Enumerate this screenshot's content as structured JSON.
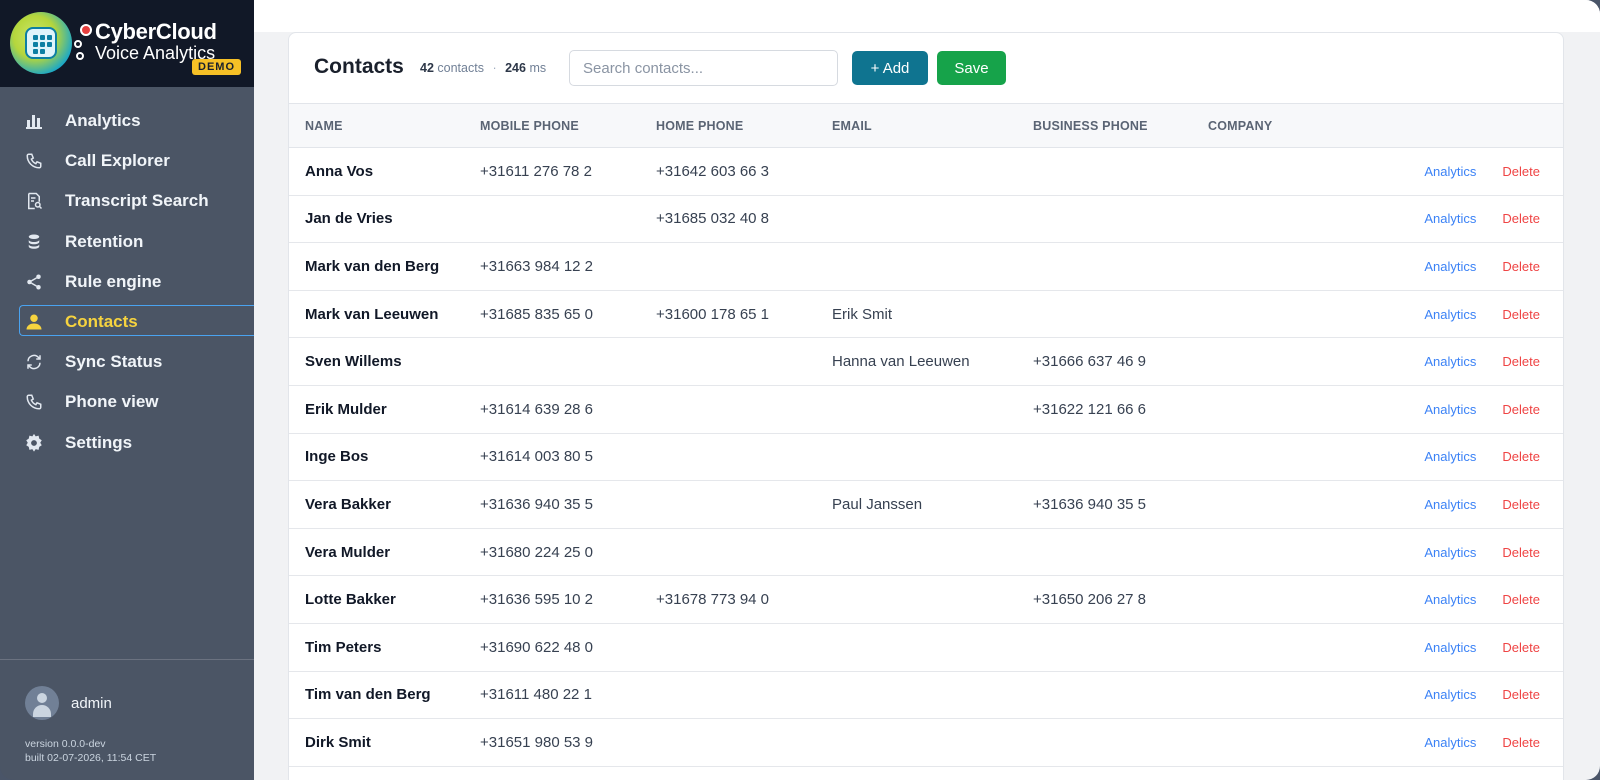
{
  "app": {
    "title": "CyberCloud",
    "subtitle": "Voice Analytics",
    "badge": "DEMO"
  },
  "sidebar": {
    "items": [
      {
        "label": "Analytics",
        "icon": "bar-chart-icon"
      },
      {
        "label": "Call Explorer",
        "icon": "phone-icon"
      },
      {
        "label": "Transcript Search",
        "icon": "document-search-icon"
      },
      {
        "label": "Retention",
        "icon": "database-icon"
      },
      {
        "label": "Rule engine",
        "icon": "share-icon"
      },
      {
        "label": "Contacts",
        "icon": "user-icon",
        "active": true
      },
      {
        "label": "Sync Status",
        "icon": "sync-icon"
      },
      {
        "label": "Phone view",
        "icon": "phone-icon"
      },
      {
        "label": "Settings",
        "icon": "gear-icon"
      }
    ],
    "user": "admin",
    "version": "version 0.0.0-dev",
    "built": "built 02-07-2026, 11:54 CET"
  },
  "header": {
    "title": "Contacts",
    "count": "42",
    "count_label": "contacts",
    "separator": "·",
    "time": "246",
    "time_label": "ms",
    "search_placeholder": "Search contacts...",
    "add_label": "+ Add",
    "save_label": "Save"
  },
  "table": {
    "columns": [
      "Name",
      "Mobile Phone",
      "Home Phone",
      "Email",
      "Business Phone",
      "Company"
    ],
    "action_analytics": "Analytics",
    "action_delete": "Delete",
    "rows": [
      {
        "name": "Anna Vos",
        "mobile": "+31611 276 78 2",
        "home": "+31642 603 66 3",
        "email": "",
        "business": "",
        "company": ""
      },
      {
        "name": "Jan de Vries",
        "mobile": "",
        "home": "+31685 032 40 8",
        "email": "",
        "business": "",
        "company": ""
      },
      {
        "name": "Mark van den Berg",
        "mobile": "+31663 984 12 2",
        "home": "",
        "email": "",
        "business": "",
        "company": ""
      },
      {
        "name": "Mark van Leeuwen",
        "mobile": "+31685 835 65 0",
        "home": "+31600 178 65 1",
        "email": "Erik Smit",
        "business": "",
        "company": ""
      },
      {
        "name": "Sven Willems",
        "mobile": "",
        "home": "",
        "email": "Hanna van Leeuwen",
        "business": "+31666 637 46 9",
        "company": ""
      },
      {
        "name": "Erik Mulder",
        "mobile": "+31614 639 28 6",
        "home": "",
        "email": "",
        "business": "+31622 121 66 6",
        "company": ""
      },
      {
        "name": "Inge Bos",
        "mobile": "+31614 003 80 5",
        "home": "",
        "email": "",
        "business": "",
        "company": ""
      },
      {
        "name": "Vera Bakker",
        "mobile": "+31636 940 35 5",
        "home": "",
        "email": "Paul Janssen",
        "business": "+31636 940 35 5",
        "company": ""
      },
      {
        "name": "Vera Mulder",
        "mobile": "+31680 224 25 0",
        "home": "",
        "email": "",
        "business": "",
        "company": ""
      },
      {
        "name": "Lotte Bakker",
        "mobile": "+31636 595 10 2",
        "home": "+31678 773 94 0",
        "email": "",
        "business": "+31650 206 27 8",
        "company": ""
      },
      {
        "name": "Tim Peters",
        "mobile": "+31690 622 48 0",
        "home": "",
        "email": "",
        "business": "",
        "company": ""
      },
      {
        "name": "Tim van den Berg",
        "mobile": "+31611 480 22 1",
        "home": "",
        "email": "",
        "business": "",
        "company": ""
      },
      {
        "name": "Dirk Smit",
        "mobile": "+31651 980 53 9",
        "home": "",
        "email": "",
        "business": "",
        "company": ""
      }
    ]
  },
  "colors": {
    "accent_active": "#f6d33f",
    "add_button": "#0f7490",
    "save_button": "#16a34a",
    "analytics_link": "#3b82f6",
    "delete_link": "#ef4444"
  }
}
